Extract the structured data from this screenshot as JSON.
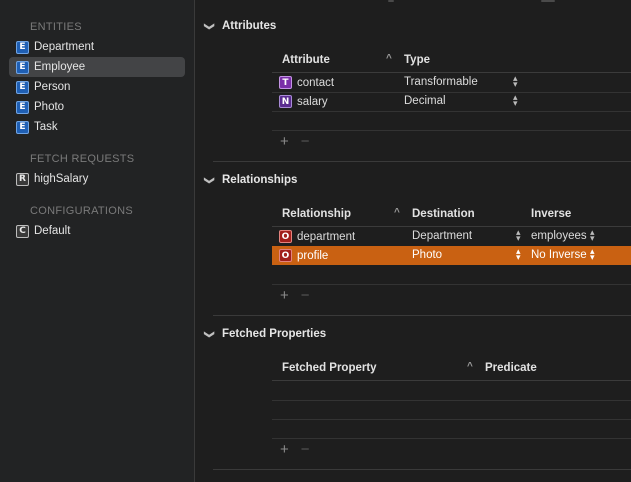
{
  "sidebar": {
    "sections": [
      {
        "header": "ENTITIES",
        "items": [
          {
            "badge": "E",
            "label": "Department",
            "selected": false
          },
          {
            "badge": "E",
            "label": "Employee",
            "selected": true
          },
          {
            "badge": "E",
            "label": "Person",
            "selected": false
          },
          {
            "badge": "E",
            "label": "Photo",
            "selected": false
          },
          {
            "badge": "E",
            "label": "Task",
            "selected": false
          }
        ]
      },
      {
        "header": "FETCH REQUESTS",
        "items": [
          {
            "badge": "R",
            "label": "highSalary",
            "selected": false
          }
        ]
      },
      {
        "header": "CONFIGURATIONS",
        "items": [
          {
            "badge": "C",
            "label": "Default",
            "selected": false
          }
        ]
      }
    ]
  },
  "attributes": {
    "title": "Attributes",
    "columns": {
      "name": "Attribute",
      "type": "Type"
    },
    "rows": [
      {
        "badge": "T",
        "name": "contact",
        "type": "Transformable"
      },
      {
        "badge": "N",
        "name": "salary",
        "type": "Decimal"
      }
    ],
    "add": "+",
    "remove": "−"
  },
  "relationships": {
    "title": "Relationships",
    "columns": {
      "name": "Relationship",
      "destination": "Destination",
      "inverse": "Inverse"
    },
    "rows": [
      {
        "badge": "O",
        "name": "department",
        "destination": "Department",
        "inverse": "employees",
        "selected": false
      },
      {
        "badge": "O",
        "name": "profile",
        "destination": "Photo",
        "inverse": "No Inverse",
        "selected": true
      }
    ],
    "add": "+",
    "remove": "−"
  },
  "fetched_properties": {
    "title": "Fetched Properties",
    "columns": {
      "name": "Fetched Property",
      "predicate": "Predicate"
    },
    "rows": [],
    "add": "+",
    "remove": "−"
  },
  "glyphs": {
    "chevron": "❯",
    "sort": "^",
    "up": "▴",
    "down": "▾"
  },
  "colors": {
    "selection": "#c96112",
    "sidebar_selected": "#434446"
  }
}
